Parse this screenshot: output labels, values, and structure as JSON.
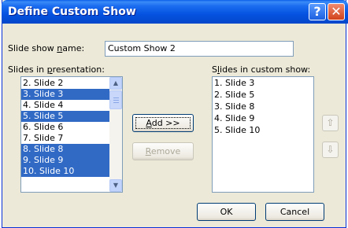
{
  "window": {
    "title": "Define Custom Show",
    "help_glyph": "?",
    "close_glyph": "✕"
  },
  "name_row": {
    "label_pre": "Slide show ",
    "label_ul": "n",
    "label_post": "ame:",
    "value": "Custom Show 2"
  },
  "left_list": {
    "label_pre": "Slides in ",
    "label_ul": "p",
    "label_post": "resentation:",
    "items": [
      {
        "text": "2. Slide 2",
        "selected": false
      },
      {
        "text": "3. Slide 3",
        "selected": true
      },
      {
        "text": "4. Slide 4",
        "selected": false
      },
      {
        "text": "5. Slide 5",
        "selected": true
      },
      {
        "text": "6. Slide 6",
        "selected": false
      },
      {
        "text": "7. Slide 7",
        "selected": false
      },
      {
        "text": "8. Slide 8",
        "selected": true
      },
      {
        "text": "9. Slide 9",
        "selected": true
      },
      {
        "text": "10. Slide 10",
        "selected": true
      }
    ]
  },
  "right_list": {
    "label_pre": "S",
    "label_ul": "l",
    "label_post": "ides in custom show:",
    "items": [
      "1. Slide 3",
      "2. Slide 5",
      "3. Slide 8",
      "4. Slide 9",
      "5. Slide 10"
    ]
  },
  "buttons": {
    "add_ul": "A",
    "add_post": "dd >>",
    "remove_ul": "R",
    "remove_post": "emove",
    "ok": "OK",
    "cancel": "Cancel"
  },
  "icons": {
    "scroll_up": "▲",
    "scroll_down": "▼",
    "move_up": "⇧",
    "move_down": "⇩"
  },
  "colors": {
    "selection": "#316ac5",
    "titlebar": "#0553e1",
    "dialog_bg": "#ece9d8"
  }
}
